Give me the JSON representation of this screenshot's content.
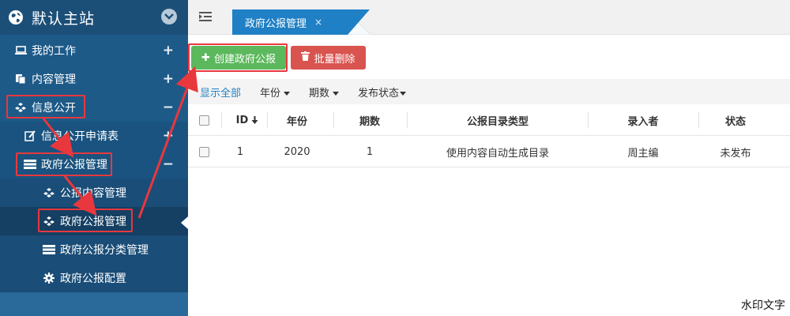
{
  "sidebar": {
    "site_title": "默认主站",
    "items": [
      {
        "label": "我的工作",
        "sign": "+"
      },
      {
        "label": "内容管理",
        "sign": "+"
      },
      {
        "label": "信息公开",
        "sign": "−"
      },
      {
        "label": "信息公开申请表",
        "sign": "+"
      },
      {
        "label": "政府公报管理",
        "sign": "−"
      },
      {
        "label": "公报内容管理"
      },
      {
        "label": "政府公报管理"
      },
      {
        "label": "政府公报分类管理"
      },
      {
        "label": "政府公报配置"
      }
    ]
  },
  "tabs": {
    "active_label": "政府公报管理",
    "close": "×"
  },
  "toolbar": {
    "create_label": "创建政府公报",
    "create_icon": "plus-icon",
    "delete_label": "批量删除",
    "delete_icon": "trash-icon"
  },
  "filters": {
    "show_all": "显示全部",
    "year": "年份",
    "period": "期数",
    "status": "发布状态"
  },
  "table": {
    "headers": [
      "ID",
      "年份",
      "期数",
      "公报目录类型",
      "录入者",
      "状态"
    ],
    "rows": [
      [
        "1",
        "2020",
        "1",
        "使用内容自动生成目录",
        "周主编",
        "未发布"
      ]
    ]
  },
  "watermark": "水印文字",
  "colors": {
    "sidebar": "#1d5a88",
    "accent": "#1f80c5",
    "success": "#5cb85c",
    "danger": "#d9534f",
    "highlight": "#e8383d"
  }
}
